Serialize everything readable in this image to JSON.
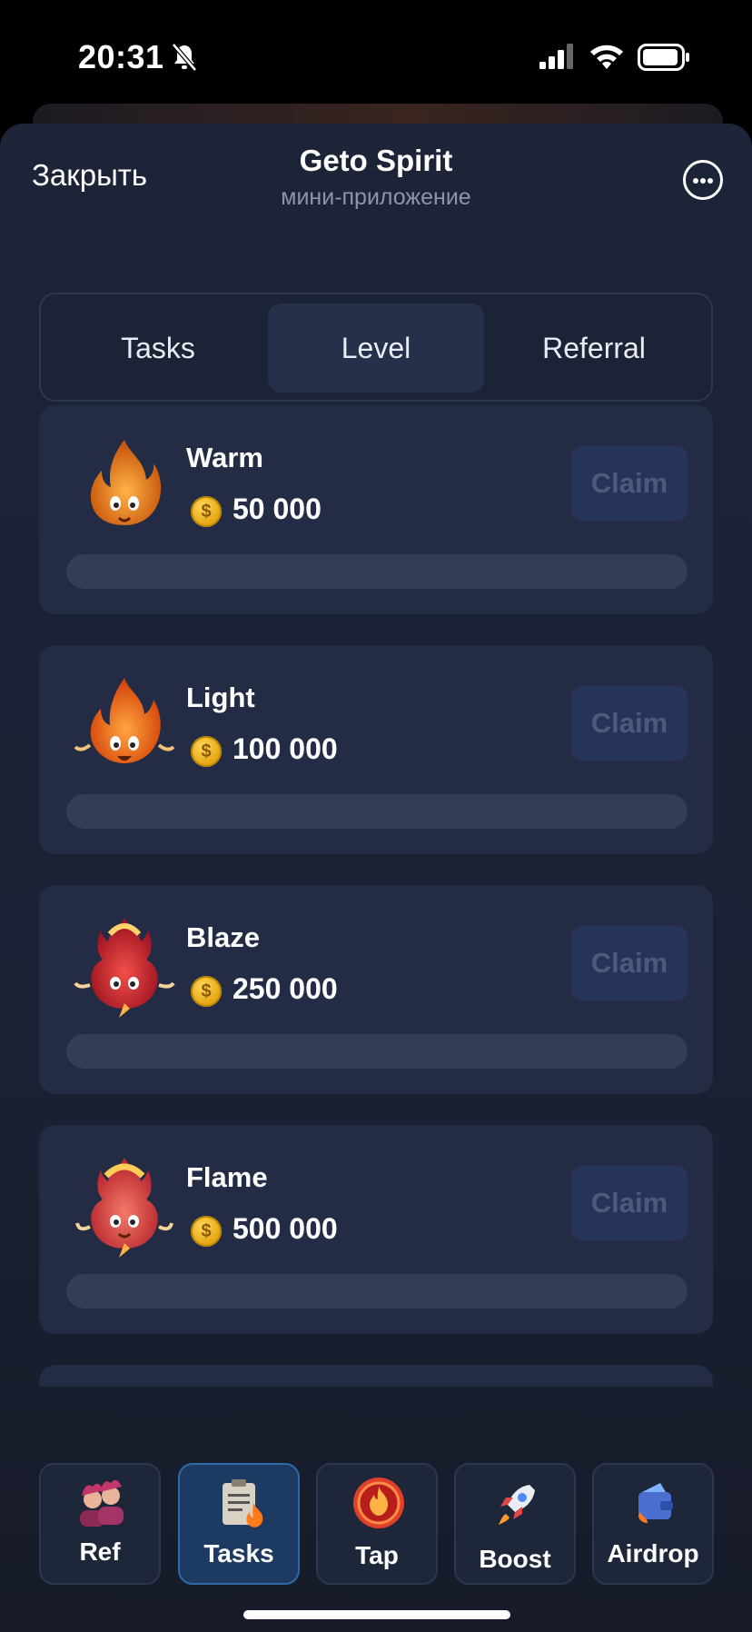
{
  "status": {
    "time": "20:31"
  },
  "header": {
    "close_label": "Закрыть",
    "title": "Geto Spirit",
    "subtitle": "мини-приложение"
  },
  "tabs": [
    {
      "label": "Tasks",
      "active": false
    },
    {
      "label": "Level",
      "active": true
    },
    {
      "label": "Referral",
      "active": false
    }
  ],
  "levels": [
    {
      "name": "Warm",
      "reward": "50 000",
      "claim_label": "Claim",
      "progress": 0,
      "icon": "warm-flame-icon"
    },
    {
      "name": "Light",
      "reward": "100 000",
      "claim_label": "Claim",
      "progress": 0,
      "icon": "light-flame-icon"
    },
    {
      "name": "Blaze",
      "reward": "250 000",
      "claim_label": "Claim",
      "progress": 0,
      "icon": "blaze-flame-icon"
    },
    {
      "name": "Flame",
      "reward": "500 000",
      "claim_label": "Claim",
      "progress": 0,
      "icon": "flame-character-icon"
    }
  ],
  "nav": [
    {
      "label": "Ref",
      "icon": "friends-icon",
      "active": false
    },
    {
      "label": "Tasks",
      "icon": "clipboard-icon",
      "active": true
    },
    {
      "label": "Tap",
      "icon": "tap-coin-icon",
      "active": false
    },
    {
      "label": "Boost",
      "icon": "rocket-icon",
      "active": false
    },
    {
      "label": "Airdrop",
      "icon": "wallet-icon",
      "active": false
    }
  ],
  "colors": {
    "background": "#1e2438",
    "card": "#232c44",
    "claim_disabled_text": "#4c5b7d",
    "nav_active": "#1c3a62"
  }
}
